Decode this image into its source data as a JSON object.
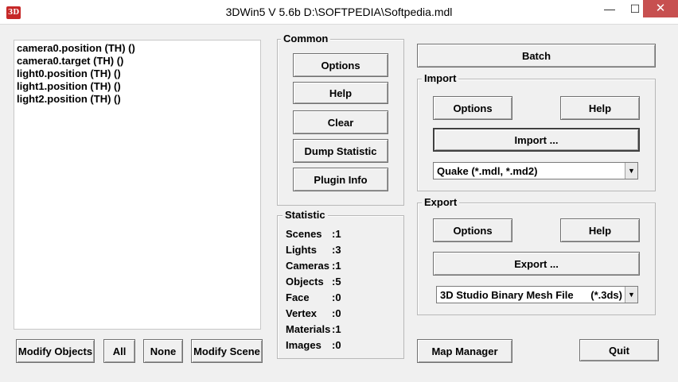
{
  "window": {
    "title": "3DWin5 V 5.6b D:\\SOFTPEDIA\\Softpedia.mdl",
    "icon_text": "3D",
    "controls": {
      "minimize": "—",
      "maximize": "☐",
      "close": "✕"
    }
  },
  "object_list": {
    "items": [
      "camera0.position (TH) ()",
      "camera0.target (TH) ()",
      "light0.position (TH) ()",
      "light1.position (TH) ()",
      "light2.position (TH) ()"
    ]
  },
  "bottom_buttons": {
    "modify_objects": "Modify Objects",
    "all": "All",
    "none": "None",
    "modify_scene": "Modify Scene"
  },
  "common": {
    "legend": "Common",
    "options": "Options",
    "help": "Help",
    "clear": "Clear",
    "dump_statistic": "Dump Statistic",
    "plugin_info": "Plugin Info"
  },
  "statistic": {
    "legend": "Statistic",
    "rows": [
      {
        "label": "Scenes",
        "value": ":1"
      },
      {
        "label": "Lights",
        "value": ":3"
      },
      {
        "label": "Cameras",
        "value": ":1"
      },
      {
        "label": "Objects",
        "value": ":5"
      },
      {
        "label": "Face",
        "value": ":0"
      },
      {
        "label": "Vertex",
        "value": ":0"
      },
      {
        "label": "Materials",
        "value": ":1"
      },
      {
        "label": "Images",
        "value": ":0"
      }
    ]
  },
  "batch": "Batch",
  "import": {
    "legend": "Import",
    "options": "Options",
    "help": "Help",
    "import_button": "Import ...",
    "format": "Quake (*.mdl, *.md2)"
  },
  "export": {
    "legend": "Export",
    "options": "Options",
    "help": "Help",
    "export_button": "Export ...",
    "format": "3D Studio Binary Mesh File      (*.3ds)"
  },
  "map_manager": "Map Manager",
  "quit": "Quit"
}
